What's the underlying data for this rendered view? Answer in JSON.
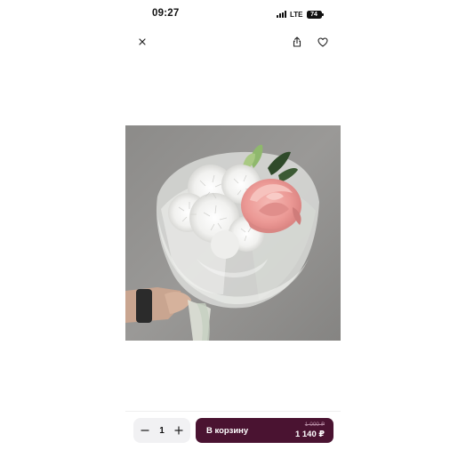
{
  "status_bar": {
    "time": "09:27",
    "network": "LTE",
    "battery": "74"
  },
  "icons": {
    "close": "close-icon",
    "share": "share-icon",
    "favorite": "heart-icon",
    "minus": "minus-icon",
    "plus": "plus-icon"
  },
  "product": {
    "image": "bouquet of white chrysanthemums and a pink rose in frosted wrapping"
  },
  "cart_bar": {
    "quantity": "1",
    "button_label": "В корзину",
    "old_price": "1 000 ₽",
    "price": "1 140 ₽"
  },
  "colors": {
    "cart_button": "#4a1331",
    "stepper_bg": "#f1f1f3"
  }
}
